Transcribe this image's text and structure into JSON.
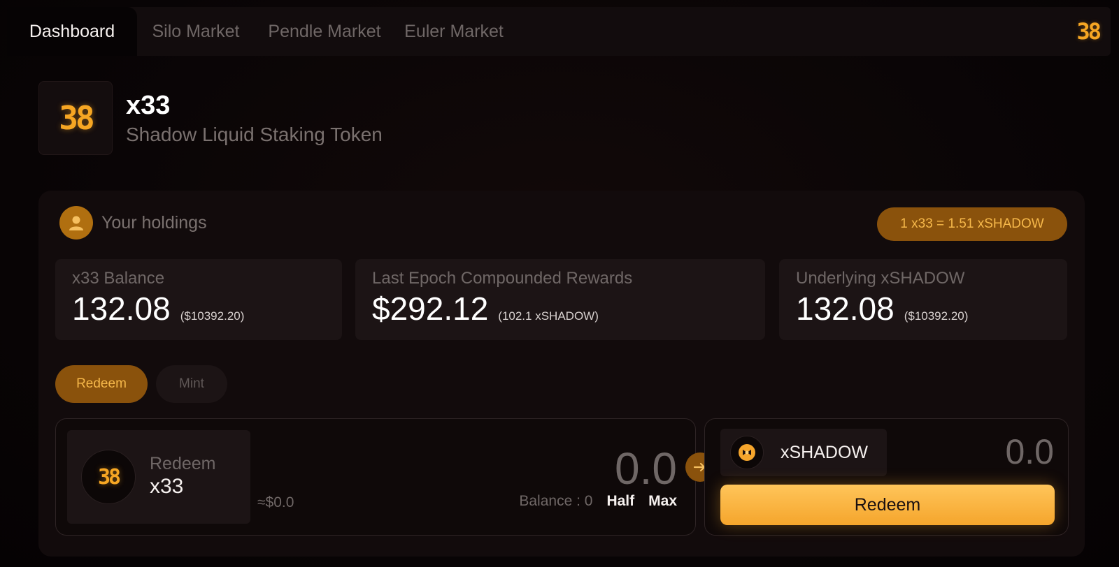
{
  "nav": {
    "tabs": [
      {
        "label": "Dashboard",
        "active": true
      },
      {
        "label": "Silo Market",
        "active": false
      },
      {
        "label": "Pendle Market",
        "active": false
      },
      {
        "label": "Euler Market",
        "active": false
      }
    ],
    "logo_text": "38"
  },
  "token": {
    "logo_text": "38",
    "name": "x33",
    "description": "Shadow Liquid Staking Token"
  },
  "holdings": {
    "label": "Your holdings",
    "rate": "1 x33 = 1.51 xSHADOW",
    "stats": [
      {
        "title": "x33 Balance",
        "value": "132.08",
        "sub": "($10392.20)"
      },
      {
        "title": "Last Epoch Compounded Rewards",
        "value": "$292.12",
        "sub": "(102.1 xSHADOW)"
      },
      {
        "title": "Underlying xSHADOW",
        "value": "132.08",
        "sub": "($10392.20)"
      }
    ]
  },
  "modes": {
    "redeem": "Redeem",
    "mint": "Mint",
    "active": "Redeem"
  },
  "input": {
    "logo_text": "38",
    "action": "Redeem",
    "token": "x33",
    "amount": "0.0",
    "usd": "≈$0.0",
    "balance": "Balance : 0",
    "half": "Half",
    "max": "Max"
  },
  "output": {
    "token": "xSHADOW",
    "amount": "0.0",
    "button": "Redeem"
  },
  "colors": {
    "accent": "#f6a623",
    "pill_bg": "#8a520c",
    "background": "#060304",
    "card": "#120b0c"
  },
  "icons": {
    "holdings": "user-icon",
    "arrow": "arrow-right-icon",
    "output_token": "xshadow-token-icon"
  }
}
